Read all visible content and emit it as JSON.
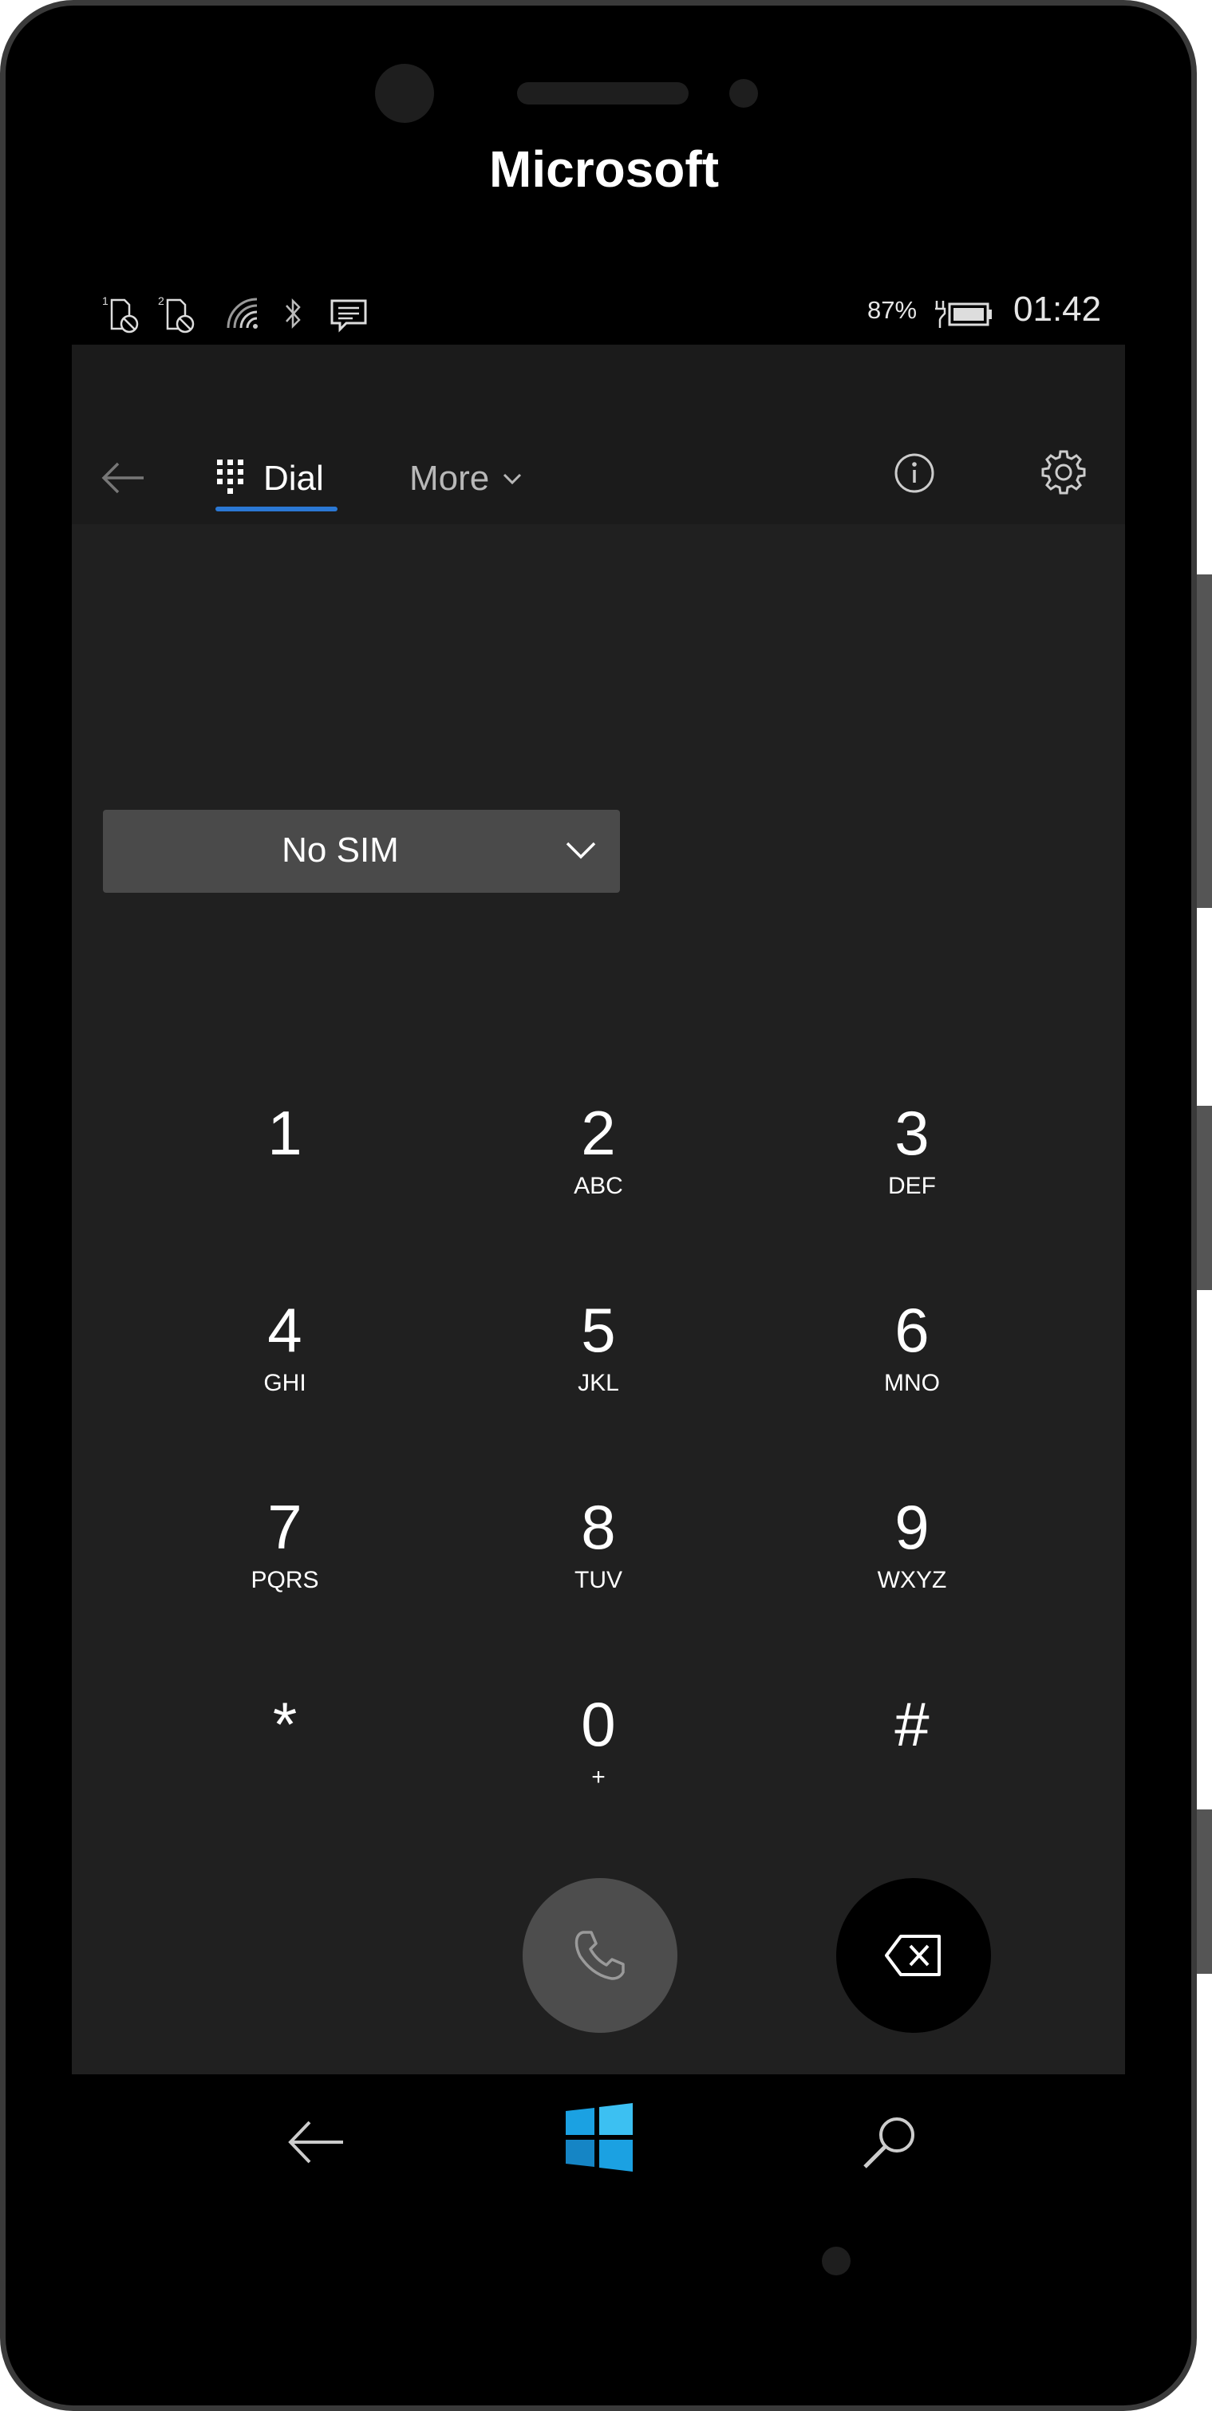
{
  "device": {
    "brand": "Microsoft"
  },
  "status_bar": {
    "icons": [
      "sim1-no-sim-icon",
      "sim2-no-sim-icon",
      "wifi-icon",
      "bluetooth-icon",
      "message-icon",
      "battery-charging-icon"
    ],
    "battery_percent": "87%",
    "time": "01:42"
  },
  "app_bar": {
    "tabs": [
      {
        "label": "Dial",
        "icon": "dialpad-icon",
        "selected": true
      },
      {
        "label": "More",
        "icon": "chevron-down-icon",
        "selected": false
      }
    ],
    "actions": [
      "info-icon",
      "gear-icon"
    ]
  },
  "sim_selector": {
    "selected": "No SIM"
  },
  "keypad": {
    "keys": [
      {
        "digit": "1",
        "letters": ""
      },
      {
        "digit": "2",
        "letters": "ABC"
      },
      {
        "digit": "3",
        "letters": "DEF"
      },
      {
        "digit": "4",
        "letters": "GHI"
      },
      {
        "digit": "5",
        "letters": "JKL"
      },
      {
        "digit": "6",
        "letters": "MNO"
      },
      {
        "digit": "7",
        "letters": "PQRS"
      },
      {
        "digit": "8",
        "letters": "TUV"
      },
      {
        "digit": "9",
        "letters": "WXYZ"
      },
      {
        "digit": "*",
        "letters": ""
      },
      {
        "digit": "0",
        "letters": "+"
      },
      {
        "digit": "#",
        "letters": ""
      }
    ]
  },
  "actions": {
    "call_icon": "phone-icon",
    "delete_icon": "backspace-icon"
  },
  "nav_bar": {
    "items": [
      "back-arrow-icon",
      "windows-logo-icon",
      "search-icon"
    ]
  },
  "colors": {
    "accent": "#2b78d4",
    "screen_background": "#202020",
    "app_bar": "#1b1b1b",
    "windows_logo": "#1ba1e2"
  }
}
